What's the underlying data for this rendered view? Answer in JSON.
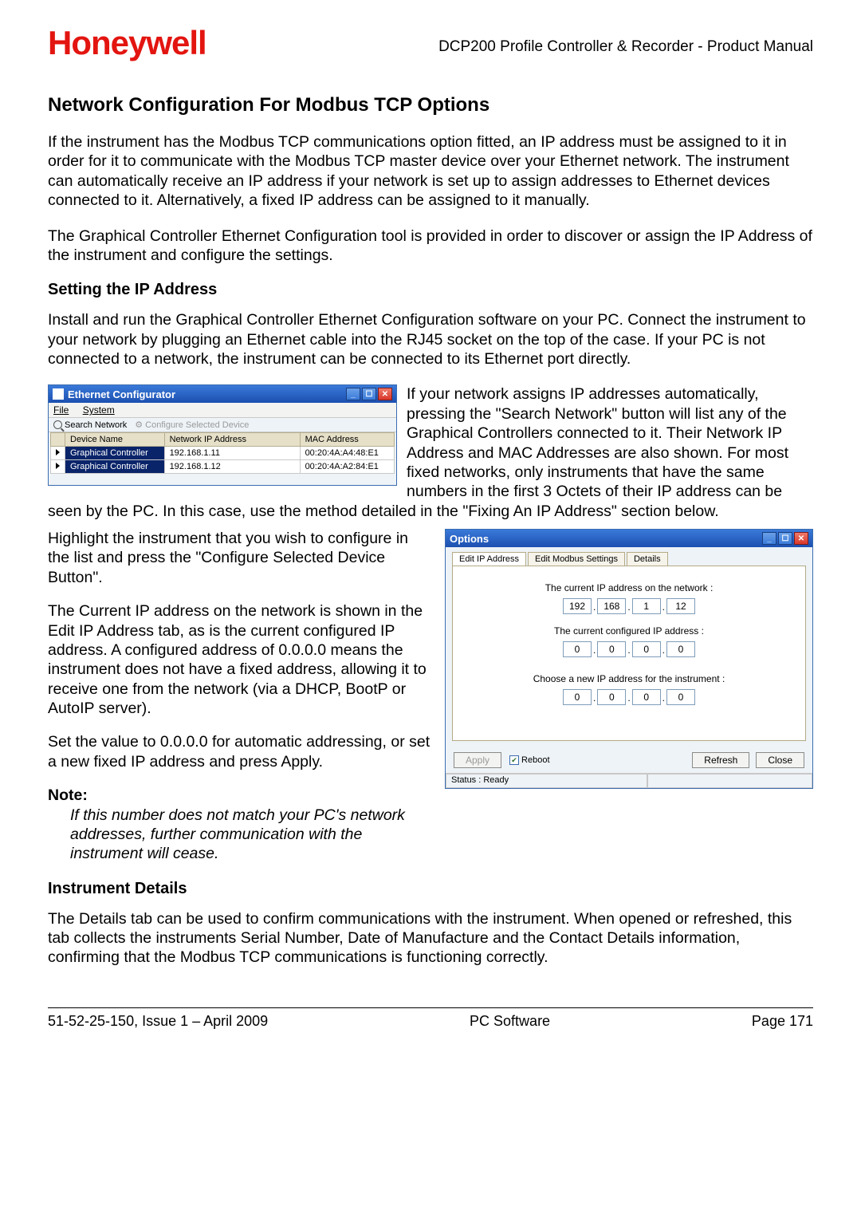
{
  "header": {
    "logo": "Honeywell",
    "doc_title": "DCP200 Profile Controller & Recorder - Product Manual"
  },
  "section_title": "Network Configuration For Modbus TCP Options",
  "para1": "If the instrument has the Modbus TCP communications option fitted, an IP address must be assigned to it in order for it to communicate with the Modbus TCP master device over your Ethernet network. The instrument can automatically receive an IP address if your network is set up to assign addresses to Ethernet devices connected to it. Alternatively, a fixed IP address can be assigned to it manually.",
  "para2": "The Graphical Controller Ethernet Configuration tool is provided in order to discover or assign the IP Address of the instrument and configure the settings.",
  "subhead1": "Setting the IP Address",
  "para3": "Install and run the Graphical Controller Ethernet Configuration software on your PC. Connect the instrument to your network by plugging an Ethernet cable into the RJ45 socket on the top of the case. If your PC is not connected to a network, the instrument can be connected to its Ethernet port directly.",
  "beside_win1": "If your network assigns IP addresses automatically, pressing the \"Search Network\" button will list any of the Graphical Controllers connected to it. Their Network IP Address and MAC Addresses are also shown. For most fixed networks, only instruments that have the same numbers in the first 3 Octets of their IP address can be seen by the PC. In this case, use the method detailed in the \"Fixing An IP Address\" section below.",
  "para4": "Highlight the instrument that you wish to configure in the list and press the \"Configure Selected Device Button\".",
  "para5": "The Current IP address on the network is shown in the Edit IP Address tab, as is the current configured IP address. A configured address of 0.0.0.0 means the instrument does not have a fixed address, allowing it to receive one from the network (via a DHCP, BootP or AutoIP server).",
  "para6": "Set the value to 0.0.0.0 for automatic addressing, or set a new fixed IP address and press Apply.",
  "note_label": "Note:",
  "note_body": "If this number does not match your PC's network addresses, further communication with the instrument will cease.",
  "subhead2": "Instrument Details",
  "para7": "The Details tab can be used to confirm communications with the instrument. When opened or refreshed, this tab collects the instruments Serial Number, Date of Manufacture and the Contact Details information, confirming that the Modbus TCP communications is functioning correctly.",
  "ethernet_configurator": {
    "title": "Ethernet Configurator",
    "menu_file": "File",
    "menu_system": "System",
    "tb_search": "Search Network",
    "tb_config": "Configure Selected Device",
    "cols": {
      "c1": "Device Name",
      "c2": "Network IP Address",
      "c3": "MAC Address"
    },
    "rows": [
      {
        "name": "Graphical Controller",
        "ip": "192.168.1.11",
        "mac": "00:20:4A:A4:48:E1"
      },
      {
        "name": "Graphical Controller",
        "ip": "192.168.1.12",
        "mac": "00:20:4A:A2:84:E1"
      }
    ]
  },
  "options_window": {
    "title": "Options",
    "tabs": {
      "t1": "Edit IP Address",
      "t2": "Edit Modbus Settings",
      "t3": "Details"
    },
    "lbl_current_net": "The current IP address on the network :",
    "ip_net": [
      "192",
      "168",
      "1",
      "12"
    ],
    "lbl_current_cfg": "The current configured IP address :",
    "ip_cfg": [
      "0",
      "0",
      "0",
      "0"
    ],
    "lbl_choose": "Choose a new IP address for the instrument :",
    "ip_new": [
      "0",
      "0",
      "0",
      "0"
    ],
    "btn_apply": "Apply",
    "chk_reboot": "Reboot",
    "btn_refresh": "Refresh",
    "btn_close": "Close",
    "status": "Status : Ready"
  },
  "footer": {
    "left": "51-52-25-150, Issue 1 – April 2009",
    "center": "PC Software",
    "right": "Page 171"
  }
}
